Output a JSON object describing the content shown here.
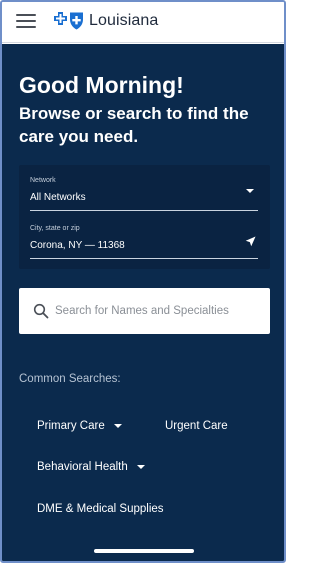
{
  "header": {
    "menu_icon": "hamburger-menu-icon",
    "logo_icon": "blue-cross-blue-shield-logo",
    "brand_name": "Louisiana"
  },
  "main": {
    "greeting": "Good Morning!",
    "subtitle": "Browse or search to find the care you need."
  },
  "filters": {
    "network": {
      "label": "Network",
      "value": "All Networks",
      "icon": "caret-down-icon"
    },
    "location": {
      "label": "City, state or zip",
      "value": "Corona, NY — 11368",
      "icon": "location-arrow-icon"
    }
  },
  "search": {
    "icon": "search-icon",
    "placeholder": "Search for Names and Specialties",
    "value": ""
  },
  "common_searches": {
    "label": "Common Searches:",
    "items": [
      {
        "label": "Primary Care",
        "has_dropdown": true
      },
      {
        "label": "Urgent Care",
        "has_dropdown": false
      },
      {
        "label": "Behavioral Health",
        "has_dropdown": true
      },
      {
        "label": "DME & Medical Supplies",
        "has_dropdown": false
      }
    ]
  },
  "colors": {
    "panel_bg": "#0b2a4d",
    "filter_bg": "#0a2342",
    "header_bg": "#ffffff",
    "brand_blue": "#1a6fd1",
    "text_light": "#ffffff"
  }
}
